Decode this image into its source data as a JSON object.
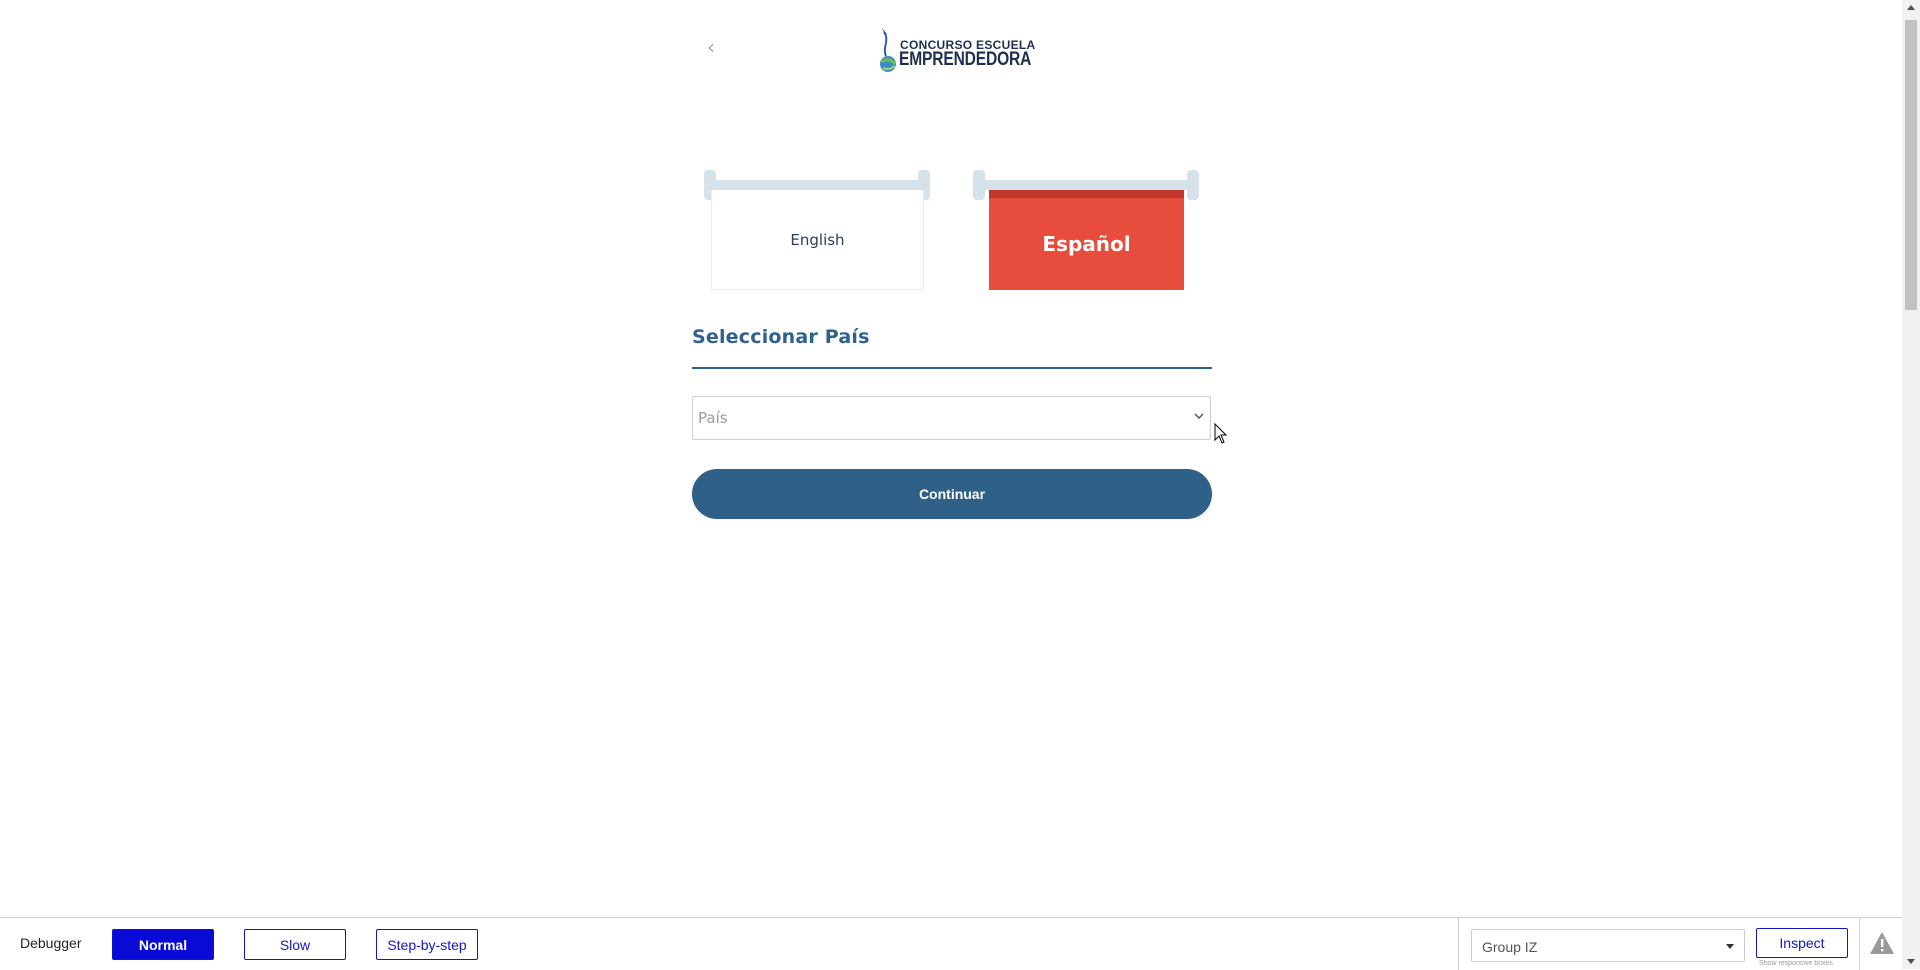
{
  "header": {
    "back_glyph": "‹",
    "logo_line1": "CONCURSO ESCUELA",
    "logo_line2": "EMPRENDEDORA"
  },
  "languages": [
    {
      "label": "English",
      "selected": false
    },
    {
      "label": "Español",
      "selected": true
    }
  ],
  "country": {
    "title": "Seleccionar País",
    "placeholder": "País",
    "continue_label": "Continuar"
  },
  "debugger": {
    "label": "Debugger",
    "modes": [
      {
        "label": "Normal",
        "active": true
      },
      {
        "label": "Slow",
        "active": false
      },
      {
        "label": "Step-by-step",
        "active": false
      }
    ],
    "group_value": "Group IZ",
    "inspect_label": "Inspect",
    "inspect_hint": "Show responsive boxes"
  },
  "colors": {
    "accent_blue": "#2e6088",
    "title_blue": "#2f6190",
    "espanol_red": "#e74c3c",
    "debug_blue": "#0a0ad6"
  }
}
